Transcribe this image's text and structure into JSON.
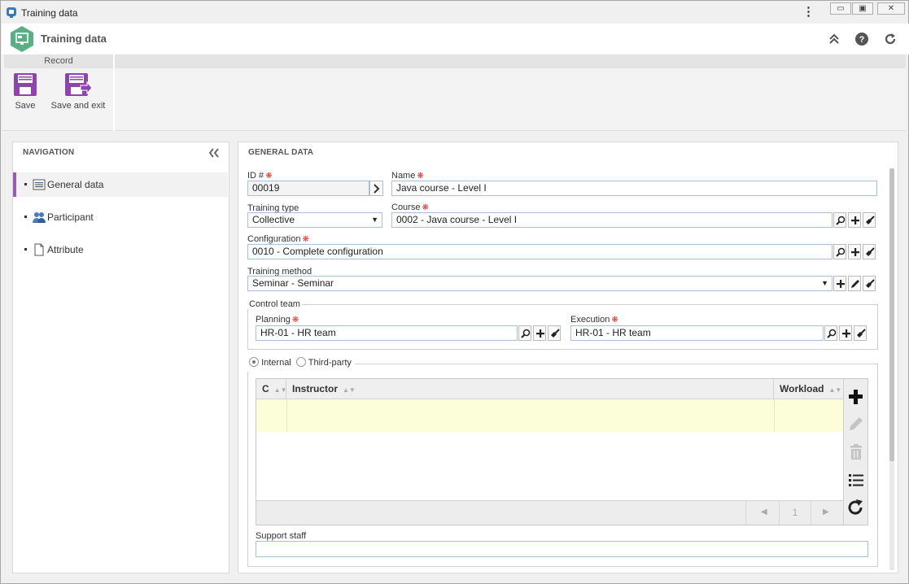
{
  "window": {
    "title": "Training data",
    "menu_icon": "kebab-menu-icon",
    "buttons": [
      "minimize-icon",
      "restore-icon",
      "close-icon"
    ]
  },
  "header": {
    "title": "Training data",
    "actions": [
      "collapse-icon",
      "help-icon",
      "refresh-icon"
    ]
  },
  "ribbon": {
    "group_label": "Record",
    "save_label": "Save",
    "save_exit_label": "Save and exit"
  },
  "navigation": {
    "title": "NAVIGATION",
    "items": [
      {
        "label": "General data",
        "icon": "list-icon",
        "active": true
      },
      {
        "label": "Participant",
        "icon": "users-icon",
        "active": false
      },
      {
        "label": "Attribute",
        "icon": "document-icon",
        "active": false
      }
    ]
  },
  "general": {
    "title": "GENERAL DATA",
    "id_label": "ID #",
    "id_value": "00019",
    "name_label": "Name",
    "name_value": "Java course - Level I",
    "training_type_label": "Training type",
    "training_type_value": "Collective",
    "course_label": "Course",
    "course_value": "0002 - Java course - Level I",
    "configuration_label": "Configuration",
    "configuration_value": "0010 - Complete configuration",
    "training_method_label": "Training method",
    "training_method_value": "Seminar - Seminar",
    "control_team_label": "Control team",
    "planning_label": "Planning",
    "planning_value": "HR-01 - HR team",
    "execution_label": "Execution",
    "execution_value": "HR-01 - HR team",
    "radio_internal": "Internal",
    "radio_third_party": "Third-party",
    "radio_selected": "Internal",
    "grid": {
      "columns": [
        "C",
        "Instructor",
        "Workload"
      ],
      "rows": [],
      "page": "1"
    },
    "support_staff_label": "Support staff",
    "support_staff_value": ""
  },
  "colors": {
    "accent": "#9b59b6",
    "required": "#d9322a",
    "grid_row_highlight": "#fcfdd9",
    "field_border": "#a6c1d8"
  }
}
